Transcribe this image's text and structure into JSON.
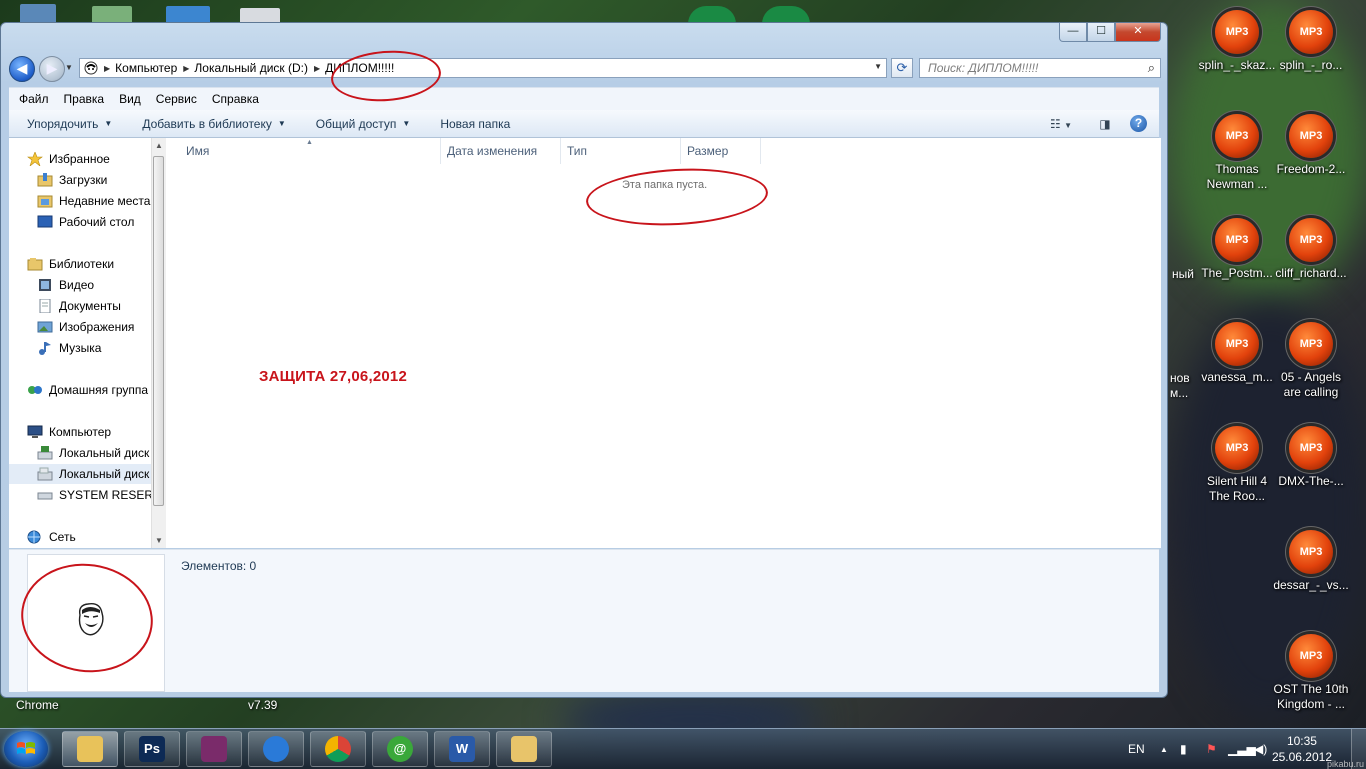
{
  "desktop": {
    "icons_right": [
      {
        "label": "splin_-_skaz...",
        "badge": "MP3"
      },
      {
        "label": "splin_-_ro...",
        "badge": "MP3"
      },
      {
        "label": "Thomas Newman ...",
        "badge": "MP3"
      },
      {
        "label": "Freedom-2...",
        "badge": "MP3"
      },
      {
        "label": "The_Postm...",
        "badge": "MP3"
      },
      {
        "label": "cliff_richard...",
        "badge": "MP3"
      },
      {
        "label": "vanessa_m...",
        "badge": "MP3"
      },
      {
        "label": "05 - Angels are calling",
        "badge": "MP3"
      },
      {
        "label": "Silent Hill 4 The Roo...",
        "badge": "MP3"
      },
      {
        "label": "DMX-The-...",
        "badge": "MP3"
      },
      {
        "label": "dessar_-_vs...",
        "badge": "MP3"
      },
      {
        "label": "OST The 10th Kingdom - ...",
        "badge": "MP3"
      }
    ],
    "partial_labels": {
      "a": "ный",
      "b": "нов",
      "c": "м...",
      "chrome": "Chrome",
      "v739": "v7.39"
    }
  },
  "window": {
    "buttons": {
      "minimize": "—",
      "maximize": "☐",
      "close": "✕"
    },
    "address": {
      "crumbs": [
        "Компьютер",
        "Локальный диск (D:)",
        "ДИПЛОМ!!!!!"
      ]
    },
    "search_placeholder": "Поиск: ДИПЛОМ!!!!!",
    "menu": [
      "Файл",
      "Правка",
      "Вид",
      "Сервис",
      "Справка"
    ],
    "commands": [
      {
        "label": "Упорядочить"
      },
      {
        "label": "Добавить в библиотеку"
      },
      {
        "label": "Общий доступ"
      },
      {
        "label": "Новая папка"
      }
    ],
    "nav": {
      "favorites": "Избранное",
      "downloads": "Загрузки",
      "recent": "Недавние места",
      "desktop": "Рабочий стол",
      "libraries": "Библиотеки",
      "video": "Видео",
      "documents": "Документы",
      "images": "Изображения",
      "music": "Музыка",
      "homegroup": "Домашняя группа",
      "computer": "Компьютер",
      "local_disk_c": "Локальный диск",
      "local_disk_d": "Локальный диск",
      "system_reserved": "SYSTEM RESERVE",
      "network": "Сеть"
    },
    "columns": [
      "Имя",
      "Дата изменения",
      "Тип",
      "Размер"
    ],
    "empty_message": "Эта папка пуста.",
    "annotation": "ЗАЩИТА 27,06,2012",
    "status": "Элементов: 0"
  },
  "taskbar": {
    "apps": [
      {
        "name": "explorer",
        "label": ""
      },
      {
        "name": "photoshop",
        "label": "Ps"
      },
      {
        "name": "winrar",
        "label": ""
      },
      {
        "name": "flashget",
        "label": ""
      },
      {
        "name": "chrome",
        "label": ""
      },
      {
        "name": "mail-agent",
        "label": "@"
      },
      {
        "name": "word",
        "label": "W"
      },
      {
        "name": "paint",
        "label": ""
      }
    ],
    "lang": "EN",
    "time": "10:35",
    "date": "25.06.2012",
    "watermark": "pikabu.ru"
  },
  "colors": {
    "accent": "#1e5dc9",
    "annotation_red": "#c8141b",
    "mp3_orange": "#e2420c"
  }
}
